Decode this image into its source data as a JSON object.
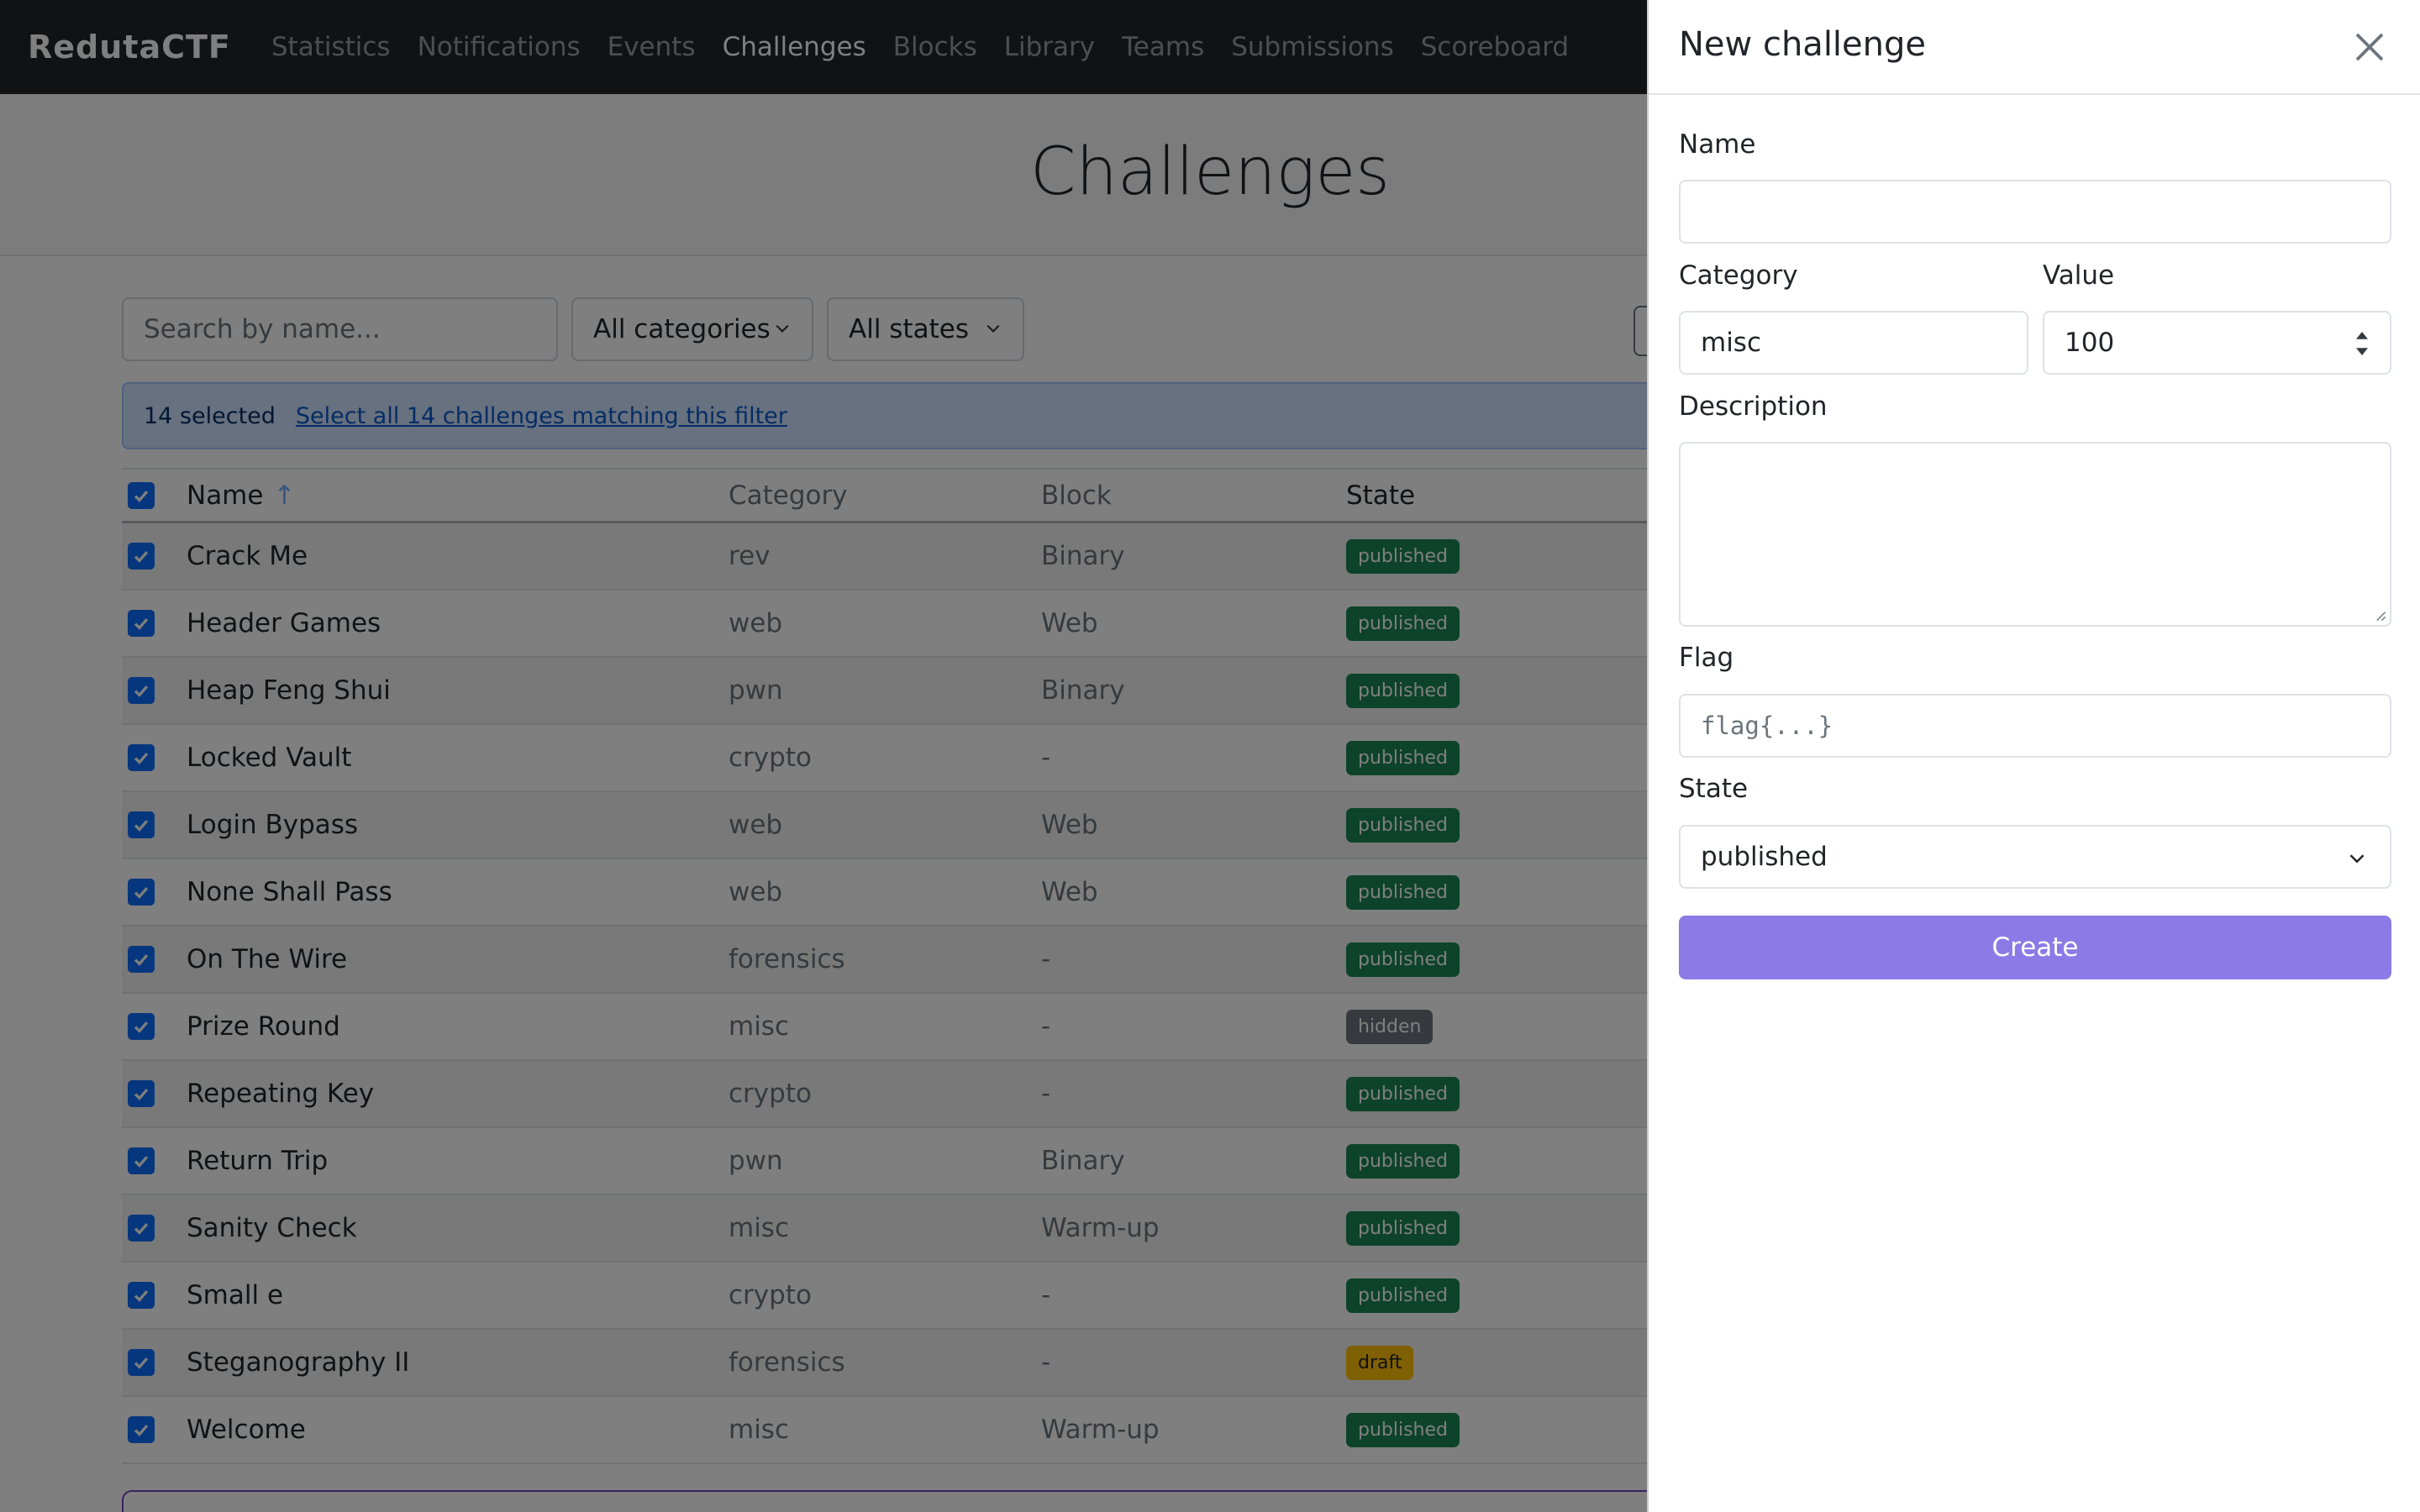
{
  "nav": {
    "brand": "RedutaCTF",
    "items": [
      {
        "label": "Statistics",
        "active": false
      },
      {
        "label": "Notifications",
        "active": false
      },
      {
        "label": "Events",
        "active": false
      },
      {
        "label": "Challenges",
        "active": true
      },
      {
        "label": "Blocks",
        "active": false
      },
      {
        "label": "Library",
        "active": false
      },
      {
        "label": "Teams",
        "active": false
      },
      {
        "label": "Submissions",
        "active": false
      },
      {
        "label": "Scoreboard",
        "active": false
      }
    ]
  },
  "page": {
    "title": "Challenges"
  },
  "filters": {
    "search_placeholder": "Search by name...",
    "category": "All categories",
    "state": "All states"
  },
  "selection": {
    "count_text": "14 selected",
    "select_all_link": "Select all 14 challenges matching this filter"
  },
  "table": {
    "headers": {
      "name": "Name",
      "category": "Category",
      "block": "Block",
      "state": "State"
    },
    "sort_indicator": "↑",
    "rows": [
      {
        "name": "Crack Me",
        "category": "rev",
        "block": "Binary",
        "state": "published"
      },
      {
        "name": "Header Games",
        "category": "web",
        "block": "Web",
        "state": "published"
      },
      {
        "name": "Heap Feng Shui",
        "category": "pwn",
        "block": "Binary",
        "state": "published"
      },
      {
        "name": "Locked Vault",
        "category": "crypto",
        "block": "-",
        "state": "published"
      },
      {
        "name": "Login Bypass",
        "category": "web",
        "block": "Web",
        "state": "published"
      },
      {
        "name": "None Shall Pass",
        "category": "web",
        "block": "Web",
        "state": "published"
      },
      {
        "name": "On The Wire",
        "category": "forensics",
        "block": "-",
        "state": "published"
      },
      {
        "name": "Prize Round",
        "category": "misc",
        "block": "-",
        "state": "hidden"
      },
      {
        "name": "Repeating Key",
        "category": "crypto",
        "block": "-",
        "state": "published"
      },
      {
        "name": "Return Trip",
        "category": "pwn",
        "block": "Binary",
        "state": "published"
      },
      {
        "name": "Sanity Check",
        "category": "misc",
        "block": "Warm-up",
        "state": "published"
      },
      {
        "name": "Small e",
        "category": "crypto",
        "block": "-",
        "state": "published"
      },
      {
        "name": "Steganography II",
        "category": "forensics",
        "block": "-",
        "state": "draft"
      },
      {
        "name": "Welcome",
        "category": "misc",
        "block": "Warm-up",
        "state": "published"
      }
    ]
  },
  "panel": {
    "title": "New challenge",
    "name_label": "Name",
    "name_value": "",
    "category_label": "Category",
    "category_value": "misc",
    "value_label": "Value",
    "value_value": "100",
    "description_label": "Description",
    "flag_label": "Flag",
    "flag_placeholder": "flag{...}",
    "state_label": "State",
    "state_value": "published",
    "create_label": "Create"
  },
  "icons": {
    "close": "close-icon",
    "chevron": "chevron-down-icon",
    "check": "check-icon",
    "spinner": "spinner-arrows-icon"
  },
  "colors": {
    "navbar": "#212529",
    "primary": "#0d6efd",
    "published": "#198754",
    "hidden": "#6c757d",
    "draft": "#ffc107",
    "create_button": "#8c7ae6"
  }
}
